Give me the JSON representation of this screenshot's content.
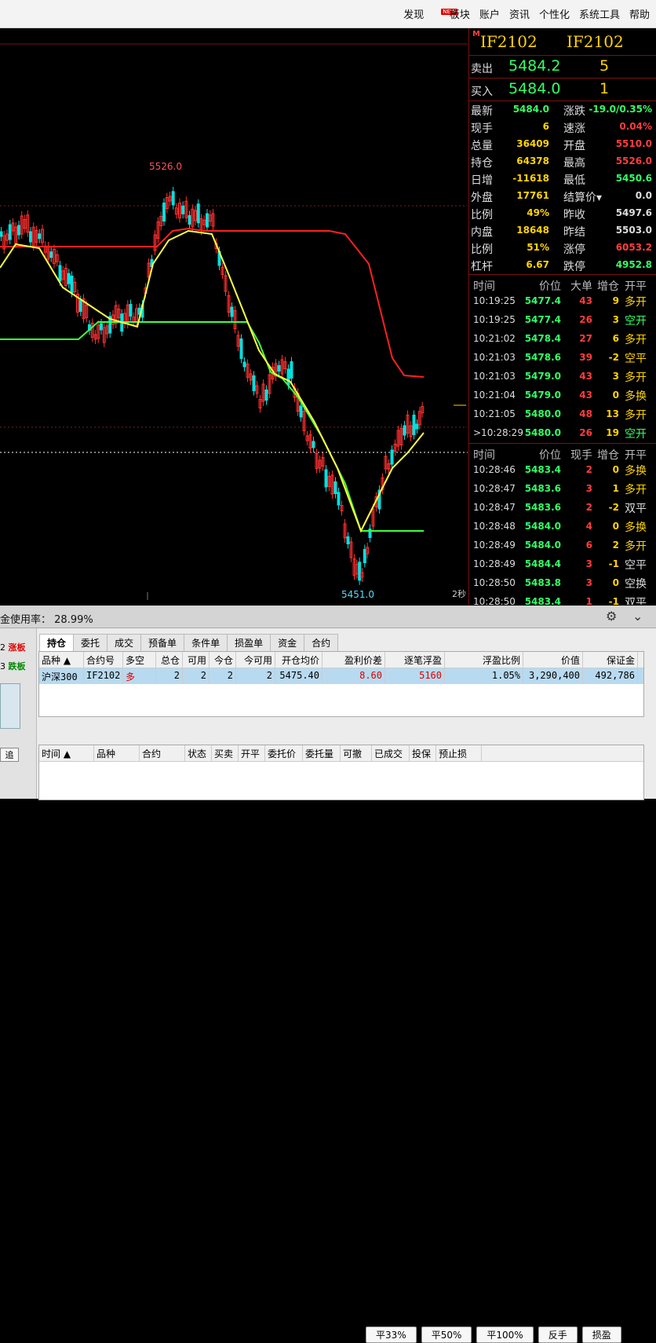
{
  "menu": {
    "items": [
      "发现",
      "板块",
      "账户",
      "资讯",
      "个性化",
      "系统工具",
      "帮助"
    ],
    "badge": "NEW"
  },
  "chart": {
    "high_label": "5526.0",
    "low_label": "5451.0",
    "timeframe": "2秒",
    "colors": {
      "up": "#ff3030",
      "down": "#00e0e0",
      "ma_fast": "#ffff40",
      "ma_mid": "#40ff40",
      "ma_slow": "#ff2020"
    }
  },
  "quote": {
    "code1": "IF2102",
    "code2": "IF2102",
    "ask_label": "卖出",
    "ask_price": "5484.2",
    "ask_vol": "5",
    "bid_label": "买入",
    "bid_price": "5484.0",
    "bid_vol": "1",
    "stats": [
      {
        "l1": "最新",
        "v1": "5484.0",
        "c1": "#33ff66",
        "l2": "涨跌",
        "v2": "-19.0/0.35%",
        "c2": "#33ff66"
      },
      {
        "l1": "现手",
        "v1": "6",
        "c1": "#ffd400",
        "l2": "速涨",
        "v2": "0.04%",
        "c2": "#ff3d3d"
      },
      {
        "l1": "总量",
        "v1": "36409",
        "c1": "#ffd400",
        "l2": "开盘",
        "v2": "5510.0",
        "c2": "#ff3d3d"
      },
      {
        "l1": "持仓",
        "v1": "64378",
        "c1": "#ffd400",
        "l2": "最高",
        "v2": "5526.0",
        "c2": "#ff3d3d"
      },
      {
        "l1": "日增",
        "v1": "-11618",
        "c1": "#ffd400",
        "l2": "最低",
        "v2": "5450.6",
        "c2": "#33ff66"
      },
      {
        "l1": "外盘",
        "v1": "17761",
        "c1": "#ffd400",
        "l2": "结算价▾",
        "v2": "0.0",
        "c2": "#ddd"
      },
      {
        "l1": "比例",
        "v1": "49%",
        "c1": "#ffd400",
        "l2": "昨收",
        "v2": "5497.6",
        "c2": "#ddd"
      },
      {
        "l1": "内盘",
        "v1": "18648",
        "c1": "#ffd400",
        "l2": "昨结",
        "v2": "5503.0",
        "c2": "#ddd"
      },
      {
        "l1": "比例",
        "v1": "51%",
        "c1": "#ffd400",
        "l2": "涨停",
        "v2": "6053.2",
        "c2": "#ff3d3d"
      },
      {
        "l1": "杠杆",
        "v1": "6.67",
        "c1": "#ffd400",
        "l2": "跌停",
        "v2": "4952.8",
        "c2": "#33ff66"
      }
    ],
    "tick1_header": [
      "时间",
      "价位",
      "大单",
      "增仓",
      "开平"
    ],
    "tick1": [
      {
        "t": "10:19:25",
        "p": "5477.4",
        "v": "43",
        "d": "9",
        "k": "多开",
        "kc": "#ffd400"
      },
      {
        "t": "10:19:25",
        "p": "5477.4",
        "v": "26",
        "d": "3",
        "k": "空开",
        "kc": "#33ff66"
      },
      {
        "t": "10:21:02",
        "p": "5478.4",
        "v": "27",
        "d": "6",
        "k": "多开",
        "kc": "#ffd400"
      },
      {
        "t": "10:21:03",
        "p": "5478.6",
        "v": "39",
        "d": "-2",
        "k": "空平",
        "kc": "#ffd400"
      },
      {
        "t": "10:21:03",
        "p": "5479.0",
        "v": "43",
        "d": "3",
        "k": "多开",
        "kc": "#ffd400"
      },
      {
        "t": "10:21:04",
        "p": "5479.0",
        "v": "43",
        "d": "0",
        "k": "多换",
        "kc": "#ffd400"
      },
      {
        "t": "10:21:05",
        "p": "5480.0",
        "v": "48",
        "d": "13",
        "k": "多开",
        "kc": "#ffd400"
      },
      {
        "t": ">10:28:29",
        "p": "5480.0",
        "v": "26",
        "d": "19",
        "k": "空开",
        "kc": "#33ff66"
      }
    ],
    "tick2_header": [
      "时间",
      "价位",
      "现手",
      "增仓",
      "开平"
    ],
    "tick2": [
      {
        "t": "10:28:46",
        "p": "5483.4",
        "v": "2",
        "d": "0",
        "k": "多换",
        "kc": "#ffd400"
      },
      {
        "t": "10:28:47",
        "p": "5483.6",
        "v": "3",
        "d": "1",
        "k": "多开",
        "kc": "#ffd400"
      },
      {
        "t": "10:28:47",
        "p": "5483.6",
        "v": "2",
        "d": "-2",
        "k": "双平",
        "kc": "#ddd"
      },
      {
        "t": "10:28:48",
        "p": "5484.0",
        "v": "4",
        "d": "0",
        "k": "多换",
        "kc": "#ffd400"
      },
      {
        "t": "10:28:49",
        "p": "5484.0",
        "v": "6",
        "d": "2",
        "k": "多开",
        "kc": "#ffd400"
      },
      {
        "t": "10:28:49",
        "p": "5484.4",
        "v": "3",
        "d": "-1",
        "k": "空平",
        "kc": "#ddd"
      },
      {
        "t": "10:28:50",
        "p": "5483.8",
        "v": "3",
        "d": "0",
        "k": "空换",
        "kc": "#ddd"
      },
      {
        "t": "10:28:50",
        "p": "5483.4",
        "v": "1",
        "d": "-1",
        "k": "双平",
        "kc": "#ddd"
      }
    ]
  },
  "panel": {
    "funds_label": "金使用率：",
    "funds_value": "28.99%",
    "side_up": "2",
    "side_up_label": "涨板",
    "side_down": "3",
    "side_down_label": "跌板",
    "side_btn": "追",
    "tabs": [
      "持仓",
      "委托",
      "成交",
      "预备单",
      "条件单",
      "损盈单",
      "资金",
      "合约"
    ],
    "pos_header": [
      "品种 ▲",
      "合约号",
      "多空",
      "总仓",
      "可用",
      "今仓",
      "今可用",
      "开仓均价",
      "盈利价差",
      "逐笔浮盈",
      "浮盈比例",
      "价值",
      "保证金"
    ],
    "pos_row": [
      "沪深300",
      "IF2102",
      "多",
      "2",
      "2",
      "2",
      "2",
      "5475.40",
      "8.60",
      "5160",
      "1.05%",
      "3,290,400",
      "492,786"
    ],
    "buttons": [
      "平33%",
      "平50%",
      "平100%",
      "反手",
      "损盈"
    ],
    "order_header": [
      "时间 ▲",
      "品种",
      "合约",
      "状态",
      "买卖",
      "开平",
      "委托价",
      "委托量",
      "可撤",
      "已成交",
      "投保",
      "预止损"
    ]
  }
}
